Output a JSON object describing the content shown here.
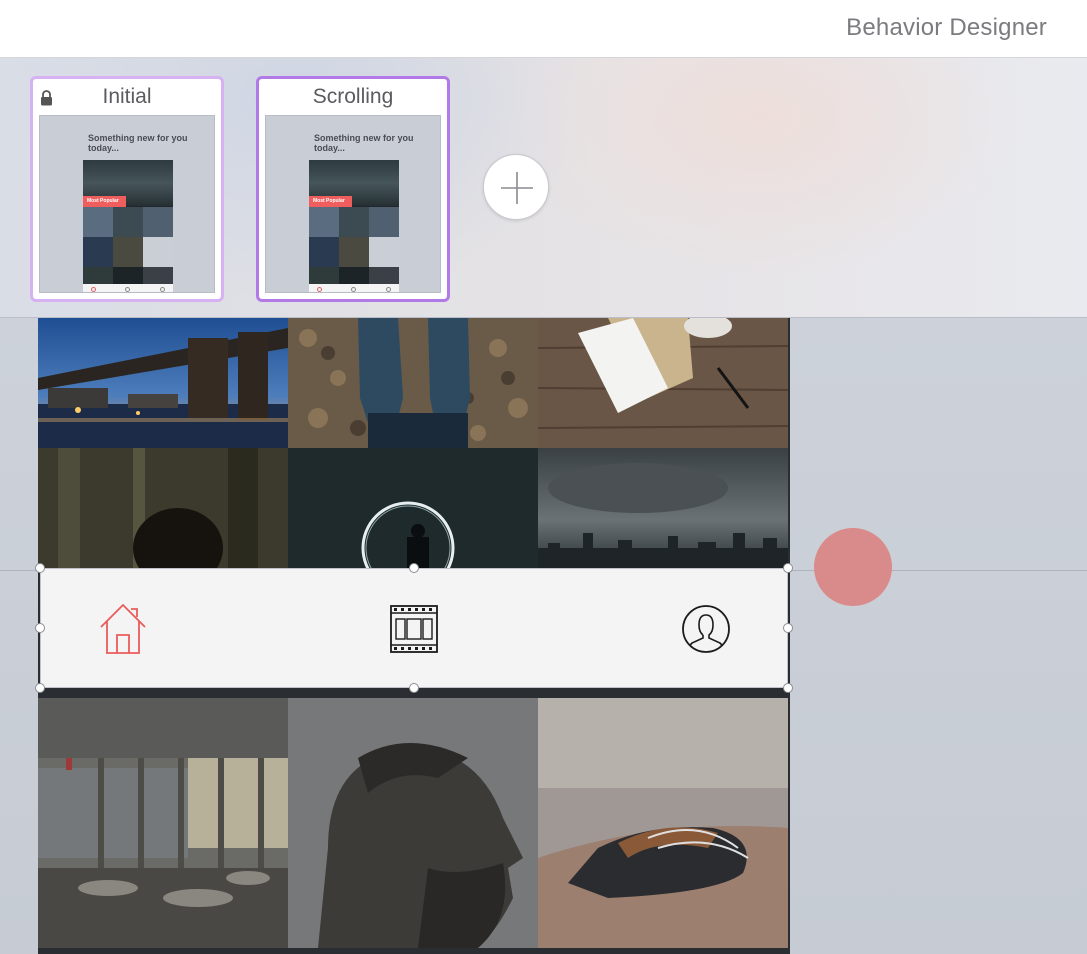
{
  "app": {
    "title": "Behavior Designer"
  },
  "states": [
    {
      "label": "Initial",
      "locked": true,
      "selected": false
    },
    {
      "label": "Scrolling",
      "locked": false,
      "selected": true
    }
  ],
  "thumbnail": {
    "headline": "Something new for you today...",
    "badge": "Most Popular"
  },
  "add_state": {
    "icon": "plus-icon"
  },
  "tabbar": {
    "tabs": [
      {
        "icon": "home-icon",
        "active": true
      },
      {
        "icon": "film-icon",
        "active": false
      },
      {
        "icon": "profile-icon",
        "active": false
      }
    ]
  },
  "photos": [
    {
      "subject": "bridge-at-night"
    },
    {
      "subject": "boots-on-leaves"
    },
    {
      "subject": "desk-with-paper"
    },
    {
      "subject": "forest-portrait"
    },
    {
      "subject": "light-circle"
    },
    {
      "subject": "city-skyline"
    },
    {
      "subject": "restaurant-interior"
    },
    {
      "subject": "bearded-man-profile"
    },
    {
      "subject": "climbing-shoe"
    }
  ],
  "colors": {
    "accent": "#b27ae6",
    "accent_light": "#d6b2f2",
    "badge": "#f05d5d",
    "active_tab": "#ea5b5b",
    "record": "#d98a8a"
  }
}
